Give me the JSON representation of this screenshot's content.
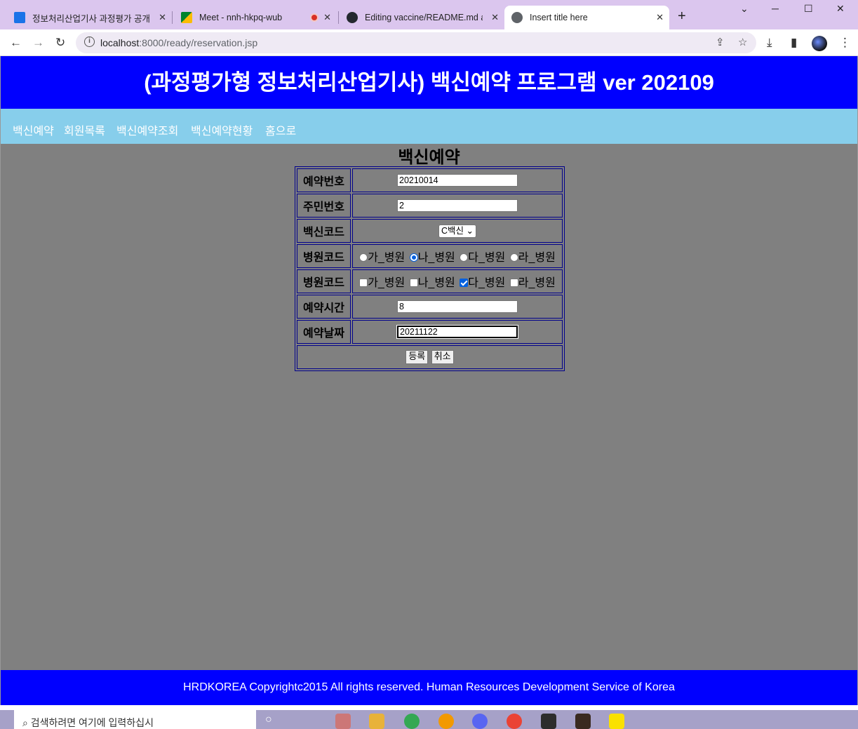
{
  "browser": {
    "tabs": [
      {
        "title": "정보처리산업기사 과정평가 공개",
        "fav_color": "#1a73e8"
      },
      {
        "title": "Meet - nnh-hkpq-wub",
        "fav_color": "#00832d"
      },
      {
        "title": "Editing vaccine/README.md at",
        "fav_color": "#24292f"
      },
      {
        "title": "Insert title here",
        "fav_color": "#5f6368"
      }
    ],
    "url_host": "localhost",
    "url_rest": ":8000/ready/reservation.jsp"
  },
  "page": {
    "banner": "(과정평가형 정보처리산업기사) 백신예약 프로그램 ver 202109",
    "nav": [
      "백신예약",
      "회원목록",
      "백신예약조회",
      "백신예약현황",
      "홈으로"
    ],
    "form_title": "백신예약",
    "fields": {
      "resv_no": {
        "label": "예약번호",
        "value": "20210014"
      },
      "jumin": {
        "label": "주민번호",
        "value": "2"
      },
      "vcode": {
        "label": "백신코드",
        "value": "C백신"
      },
      "hospital_radio": {
        "label": "병원코드",
        "options": [
          "가_병원",
          "나_병원",
          "다_병원",
          "라_병원"
        ],
        "selected": "나_병원"
      },
      "hospital_check": {
        "label": "병원코드",
        "options": [
          "가_병원",
          "나_병원",
          "다_병원",
          "라_병원"
        ],
        "checked": [
          "다_병원"
        ]
      },
      "resv_time": {
        "label": "예약시간",
        "value": "8"
      },
      "resv_date": {
        "label": "예약날짜",
        "value": "20211122"
      }
    },
    "buttons": {
      "submit": "등록",
      "cancel": "취소"
    },
    "footer": "HRDKOREA Copyrightc2015 All rights reserved. Human Resources Development Service of Korea"
  },
  "taskbar": {
    "search_placeholder": "검색하려면 여기에 입력하십시"
  },
  "colors": {
    "banner": "#0000ff",
    "nav": "#87ceeb",
    "background": "#808080",
    "footer": "#0000ff"
  }
}
